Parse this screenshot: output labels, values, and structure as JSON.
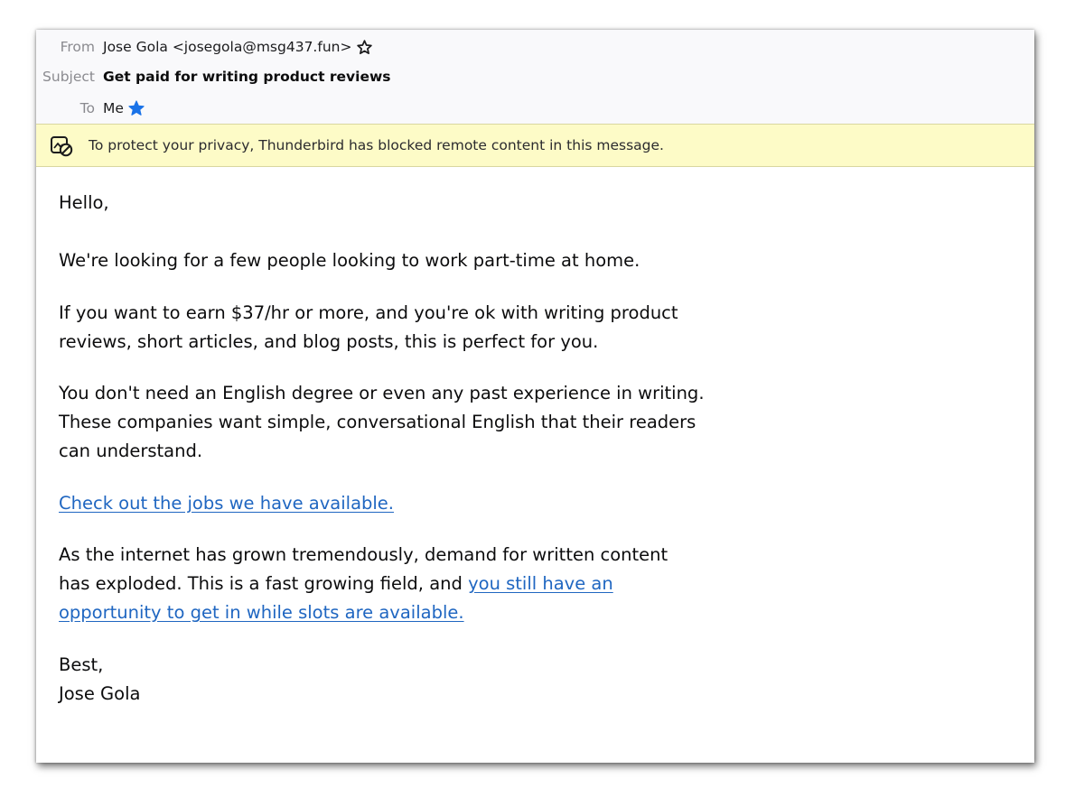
{
  "header": {
    "from_label": "From",
    "from_value": "Jose Gola <josegola@msg437.fun>",
    "subject_label": "Subject",
    "subject_value": "Get paid for writing product reviews",
    "to_label": "To",
    "to_value": "Me",
    "star_icon": "star-outline-icon",
    "contact_star_icon": "star-filled-icon",
    "accent_color": "#1a73e8"
  },
  "notice": {
    "icon": "blocked-content-icon",
    "text": "To protect your privacy, Thunderbird has blocked remote content in this message.",
    "background": "#fdfbc7"
  },
  "message": {
    "greeting": "Hello,",
    "p1": "We're looking for a few people looking to work part-time at home.",
    "p2_line1": "If you want to earn $37/hr or more, and you're ok with writing product",
    "p2_line2": "reviews, short articles, and blog posts, this is perfect for you.",
    "p3_line1": "You don't need an English degree or even any past experience in writing.",
    "p3_line2": "These companies want simple, conversational English that their readers",
    "p3_line3": "can understand.",
    "link1": "Check out the jobs we have available.",
    "p5_line1": "As the internet has grown tremendously, demand for written content",
    "p5_line2_text": "has exploded. This is a fast growing field, and ",
    "p5_line2_link": "you still have an",
    "p5_line3_link": "opportunity to get in while slots are available.",
    "closing": "Best,",
    "signature": "Jose Gola",
    "link_color": "#1f66c1"
  }
}
